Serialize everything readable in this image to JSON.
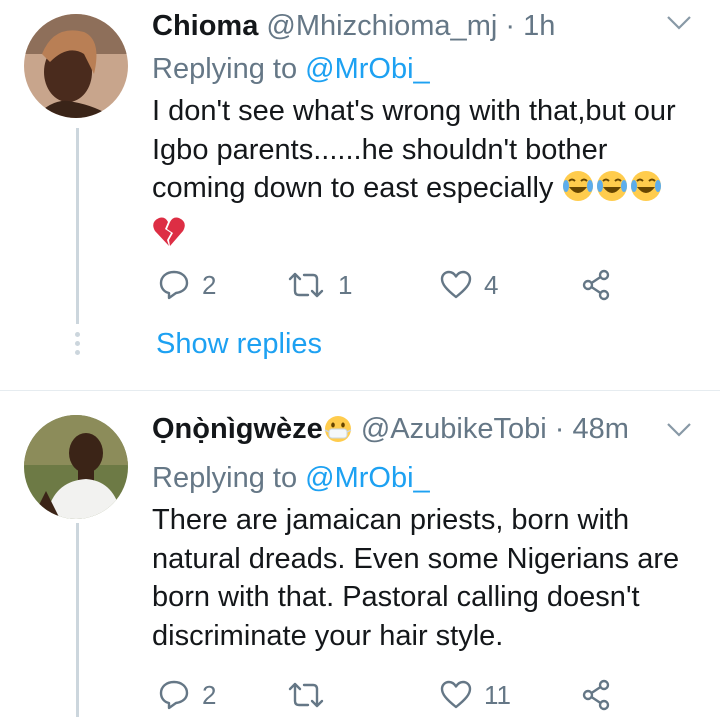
{
  "tweets": [
    {
      "name": "Chioma",
      "handle": "@Mhizchioma_mj",
      "dot": "·",
      "time": "1h",
      "replying_prefix": "Replying to ",
      "replying_to": "@MrObi_",
      "text": "I don't see what's wrong with that,but our Igbo parents......he shouldn't bother coming down to east especially",
      "emojis": [
        "tears-of-joy-emoji",
        "tears-of-joy-emoji",
        "tears-of-joy-emoji",
        "broken-heart-emoji"
      ],
      "replies": "2",
      "retweets": "1",
      "likes": "4",
      "show_replies": "Show replies"
    },
    {
      "name": "Ọnọ̀nìgwèze",
      "name_emoji": "face-with-medical-mask-emoji",
      "handle": "@AzubikeTobi",
      "dot": "·",
      "time": "48m",
      "replying_prefix": "Replying to ",
      "replying_to": "@MrObi_",
      "text": "There are jamaican priests, born with natural dreads. Even some Nigerians are born with that. Pastoral calling doesn't discriminate your hair style.",
      "replies": "2",
      "retweets": "",
      "likes": "11"
    }
  ],
  "colors": {
    "accent": "#1da1f2",
    "secondary_text": "#657786",
    "primary_text": "#14171a",
    "divider": "#e6ecf0",
    "thread_line": "#ccd6dd"
  }
}
